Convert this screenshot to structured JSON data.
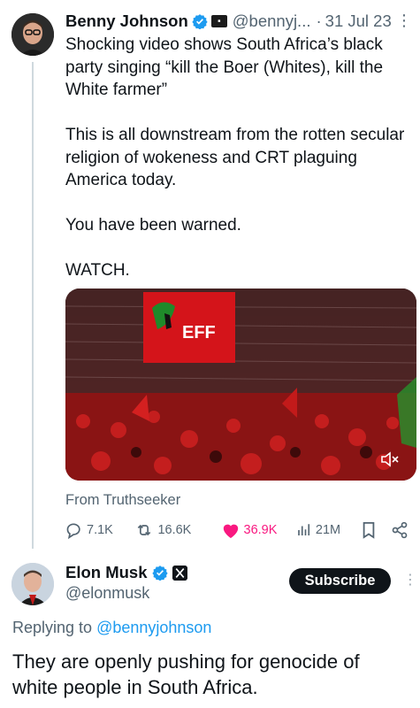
{
  "tweet": {
    "author_name": "Benny Johnson",
    "author_handle": "@bennyj...",
    "separator": "·",
    "date": "31 Jul 23",
    "body": "Shocking video shows South Africa’s black party singing “kill the Boer (Whites), kill the White farmer”\n\nThis is all downstream from the rotten secular religion of wokeness and CRT plaguing America today.\n\nYou have been warned.\n\nWATCH.",
    "video": {
      "banner_text": "EFF",
      "sound_icon": "mute-icon"
    },
    "source": "From Truthseeker",
    "stats": {
      "replies": "7.1K",
      "reposts": "16.6K",
      "likes": "36.9K",
      "views": "21M"
    }
  },
  "reply": {
    "author_name": "Elon Musk",
    "author_handle": "@elonmusk",
    "subscribe_label": "Subscribe",
    "replying_prefix": "Replying to ",
    "replying_handle": "@bennyjohnson",
    "body": "They are openly pushing for genocide of white people in South Africa."
  },
  "colors": {
    "verified": "#1d9bf0",
    "like": "#f91880",
    "muted": "#536471",
    "link": "#1d9bf0"
  }
}
